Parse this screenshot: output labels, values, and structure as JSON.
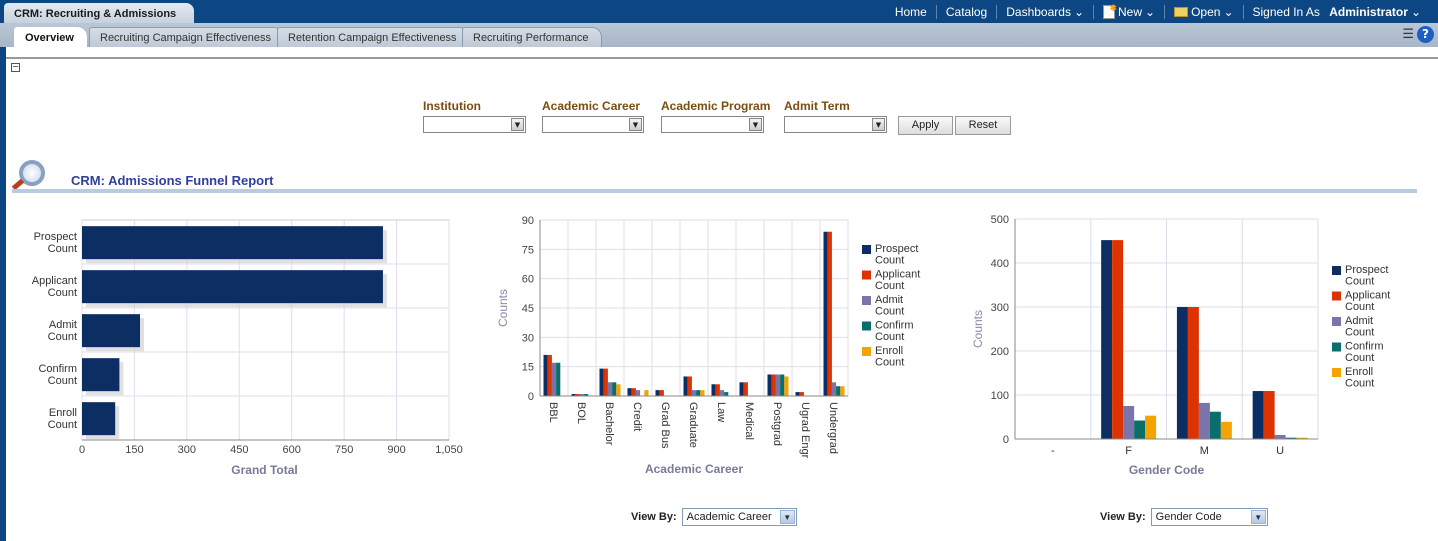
{
  "app_title": "CRM: Recruiting & Admissions",
  "global_nav": {
    "home": "Home",
    "catalog": "Catalog",
    "dashboards": "Dashboards",
    "new": "New",
    "open": "Open",
    "signed_in_as": "Signed In As",
    "user": "Administrator"
  },
  "tabs": [
    {
      "label": "Overview",
      "active": true
    },
    {
      "label": "Recruiting Campaign Effectiveness"
    },
    {
      "label": "Retention Campaign Effectiveness"
    },
    {
      "label": "Recruiting Performance"
    }
  ],
  "filters": {
    "labels": [
      "Institution",
      "Academic Career",
      "Academic Program",
      "Admit Term"
    ],
    "values": [
      "",
      "",
      "",
      ""
    ],
    "apply": "Apply",
    "reset": "Reset"
  },
  "section_title": "CRM: Admissions Funnel Report",
  "colors": {
    "prospect": "#0d2e62",
    "applicant": "#dd3300",
    "admit": "#7a74aa",
    "confirm": "#0a6e6a",
    "enroll": "#f5a300",
    "header": "#0d4783"
  },
  "view_by": [
    {
      "label": "View By:",
      "value": "Academic Career"
    },
    {
      "label": "View By:",
      "value": "Gender Code"
    }
  ],
  "chart_data": [
    {
      "type": "bar",
      "orientation": "horizontal",
      "categories": [
        "Prospect Count",
        "Applicant Count",
        "Admit Count",
        "Confirm Count",
        "Enroll Count"
      ],
      "values": [
        861,
        861,
        166,
        107,
        95
      ],
      "xlabel": "Grand Total",
      "xlim": [
        0,
        1050
      ],
      "ticks": [
        "0",
        "150",
        "300",
        "450",
        "600",
        "750",
        "900",
        "1,050"
      ],
      "grid": true
    },
    {
      "type": "bar",
      "categories": [
        "BBL",
        "BOL",
        "Bachelor",
        "Credit",
        "Grad Bus",
        "Graduate",
        "Law",
        "Medical",
        "Postgrad",
        "Ugrad Engr",
        "Undergrad"
      ],
      "series": [
        {
          "name": "Prospect Count",
          "values": [
            21,
            1,
            14,
            4,
            3,
            10,
            6,
            7,
            11,
            2,
            84
          ]
        },
        {
          "name": "Applicant Count",
          "values": [
            21,
            1,
            14,
            4,
            3,
            10,
            6,
            7,
            11,
            2,
            84
          ]
        },
        {
          "name": "Admit Count",
          "values": [
            17,
            1,
            7,
            3,
            0,
            3,
            3,
            0,
            11,
            0,
            7
          ]
        },
        {
          "name": "Confirm Count",
          "values": [
            17,
            1,
            7,
            0,
            0,
            3,
            2,
            0,
            11,
            0,
            5
          ]
        },
        {
          "name": "Enroll Count",
          "values": [
            0,
            0,
            6,
            3,
            0,
            3,
            0,
            0,
            10,
            0,
            5
          ]
        }
      ],
      "xlabel": "Academic Career",
      "ylabel": "Counts",
      "ylim": [
        0,
        90
      ],
      "ticks": [
        "0",
        "15",
        "30",
        "45",
        "60",
        "75",
        "90"
      ],
      "legend": "right",
      "grid": true
    },
    {
      "type": "bar",
      "categories": [
        "-",
        "F",
        "M",
        "U"
      ],
      "series": [
        {
          "name": "Prospect Count",
          "values": [
            0,
            452,
            300,
            109
          ]
        },
        {
          "name": "Applicant Count",
          "values": [
            0,
            452,
            300,
            109
          ]
        },
        {
          "name": "Admit Count",
          "values": [
            0,
            75,
            82,
            9
          ]
        },
        {
          "name": "Confirm Count",
          "values": [
            0,
            42,
            62,
            3
          ]
        },
        {
          "name": "Enroll Count",
          "values": [
            0,
            53,
            39,
            3
          ]
        }
      ],
      "xlabel": "Gender Code",
      "ylabel": "Counts",
      "ylim": [
        0,
        500
      ],
      "ticks": [
        "0",
        "100",
        "200",
        "300",
        "400",
        "500"
      ],
      "legend": "right",
      "grid": true
    }
  ]
}
